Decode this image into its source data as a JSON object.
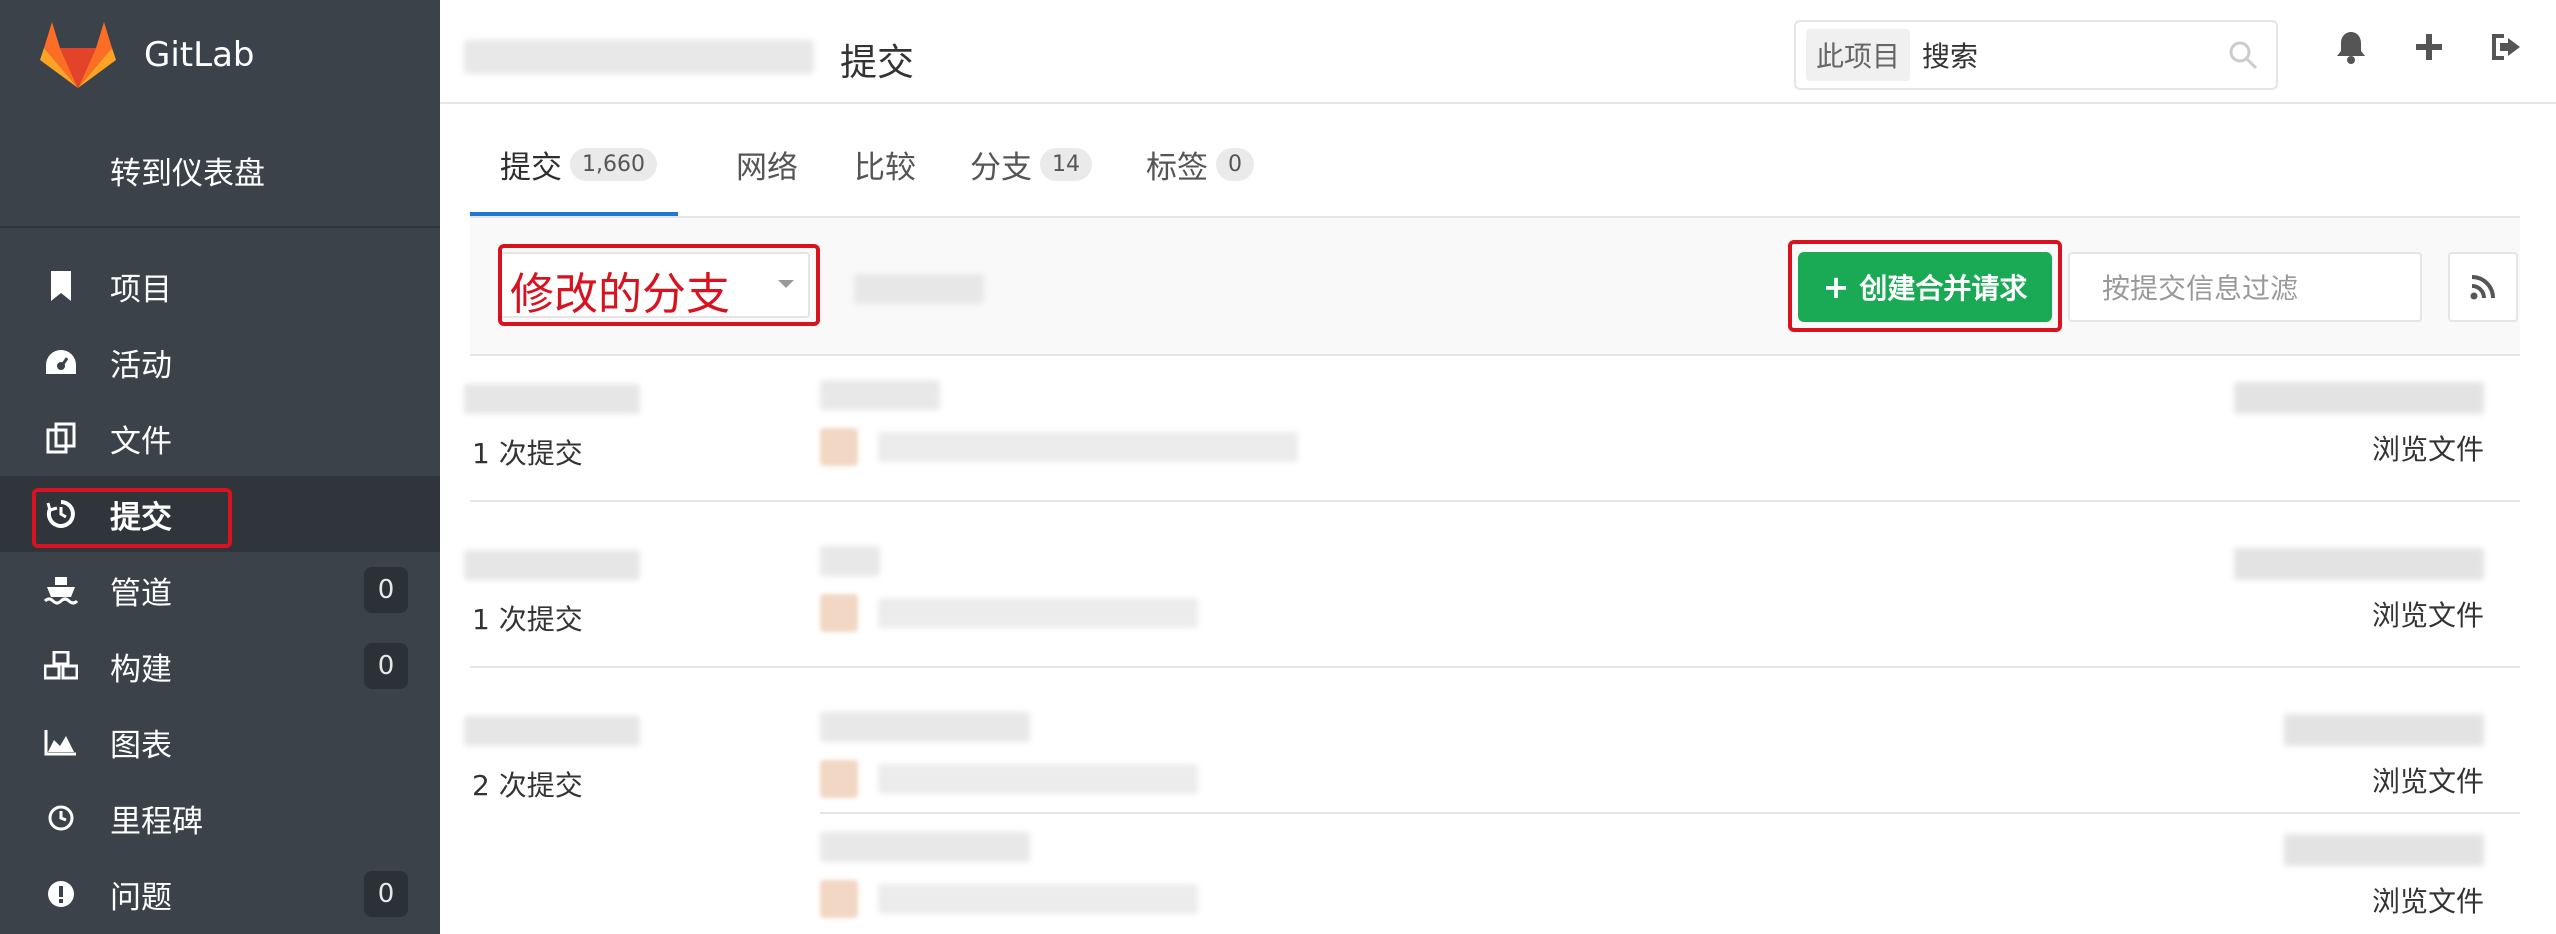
{
  "brand": {
    "name": "GitLab"
  },
  "sidebar": {
    "dashboard": "转到仪表盘",
    "items": [
      {
        "label": "项目",
        "icon": "bookmark-icon"
      },
      {
        "label": "活动",
        "icon": "dashboard-icon"
      },
      {
        "label": "文件",
        "icon": "files-icon"
      },
      {
        "label": "提交",
        "icon": "history-icon",
        "active": true
      },
      {
        "label": "管道",
        "icon": "ship-icon",
        "count": "0"
      },
      {
        "label": "构建",
        "icon": "cubes-icon",
        "count": "0"
      },
      {
        "label": "图表",
        "icon": "area-chart-icon"
      },
      {
        "label": "里程碑",
        "icon": "clock-icon"
      },
      {
        "label": "问题",
        "icon": "exclamation-circle-icon",
        "count": "0"
      }
    ]
  },
  "header": {
    "title": "提交",
    "search_scope": "此项目",
    "search_placeholder": "搜索"
  },
  "tabs": [
    {
      "label": "提交",
      "badge": "1,660"
    },
    {
      "label": "网络"
    },
    {
      "label": "比较"
    },
    {
      "label": "分支",
      "badge": "14"
    },
    {
      "label": "标签",
      "badge": "0"
    }
  ],
  "filters": {
    "branch_annotation": "修改的分支",
    "create_mr_label": "创建合并请求",
    "filter_placeholder": "按提交信息过滤"
  },
  "commit_groups": [
    {
      "count_label": "1 次提交",
      "browse_label": "浏览文件"
    },
    {
      "count_label": "1 次提交",
      "browse_label": "浏览文件"
    },
    {
      "count_label": "2 次提交",
      "browse_label": "浏览文件",
      "second_browse_label": "浏览文件"
    }
  ],
  "colors": {
    "sidebar_bg": "#3b4249",
    "accent_blue": "#1f78d1",
    "success_green": "#1aaa55",
    "annotation_red": "#d8121f"
  }
}
